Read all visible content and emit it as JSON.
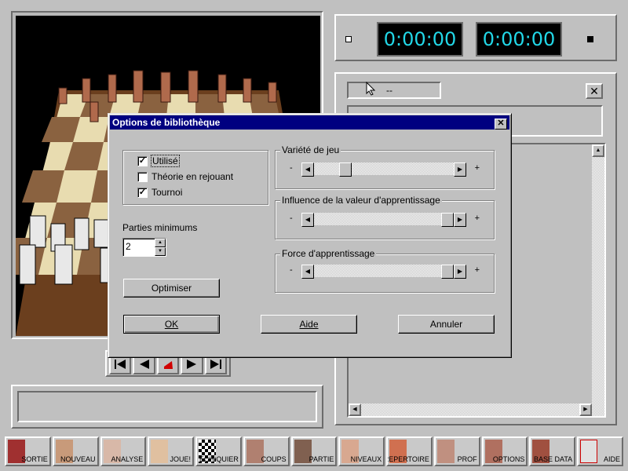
{
  "clocks": {
    "left_time": "0:00:00",
    "right_time": "0:00:00",
    "time_color": "#22d8e8"
  },
  "info_panel": {
    "move_field": "--",
    "close_glyph": "✕"
  },
  "toolbar": {
    "items": [
      {
        "label": "SORTIE",
        "icon": "exit-door-icon"
      },
      {
        "label": "NOUVEAU",
        "icon": "new-game-icon"
      },
      {
        "label": "ANALYSE",
        "icon": "eye-icon"
      },
      {
        "label": "JOUE!",
        "icon": "play-hand-icon"
      },
      {
        "label": "ECHIQUIER",
        "icon": "chessboard-icon"
      },
      {
        "label": "COUPS",
        "icon": "moves-icon"
      },
      {
        "label": "PARTIE",
        "icon": "game-piece-icon"
      },
      {
        "label": "NIVEAUX",
        "icon": "stairs-icon"
      },
      {
        "label": "REPERTOIRE",
        "icon": "repertoire-icon"
      },
      {
        "label": "PROF",
        "icon": "professor-icon"
      },
      {
        "label": "OPTIONS",
        "icon": "options-icon"
      },
      {
        "label": "BASE DATA",
        "icon": "database-books-icon"
      },
      {
        "label": "AIDE",
        "icon": "first-aid-icon"
      }
    ]
  },
  "dialog": {
    "title": "Options de bibliothèque",
    "close_glyph": "✕",
    "checkboxes": [
      {
        "label": "Utilisé",
        "checked": true,
        "mark": "✓"
      },
      {
        "label": "Théorie en rejouant",
        "checked": false,
        "mark": ""
      },
      {
        "label": "Tournoi",
        "checked": true,
        "mark": "✓"
      }
    ],
    "min_games_label": "Parties minimums",
    "min_games_value": "2",
    "optimize_label": "Optimiser",
    "sliders": [
      {
        "title": "Variété de jeu",
        "minus": "-",
        "plus": "+",
        "level": 0.2
      },
      {
        "title": "Influence de la valeur d'apprentissage",
        "minus": "-",
        "plus": "+",
        "level": 1.0
      },
      {
        "title": "Force d'apprentissage",
        "minus": "-",
        "plus": "+",
        "level": 1.0
      }
    ],
    "ok_label": "OK",
    "help_label": "Aide",
    "cancel_label": "Annuler"
  },
  "nav": {
    "buttons": [
      "first",
      "back",
      "stop",
      "forward",
      "last"
    ]
  }
}
